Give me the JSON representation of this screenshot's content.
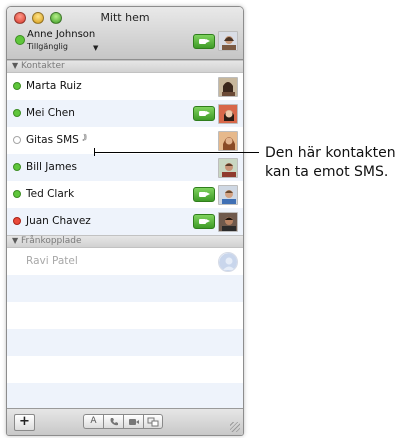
{
  "window": {
    "title": "Mitt hem"
  },
  "me": {
    "name": "Anne Johnson",
    "status": "Tillgänglig",
    "status_color": "#5fc63b"
  },
  "groups": {
    "contacts_label": "Kontakter",
    "offline_label": "Frånkopplade"
  },
  "contacts": [
    {
      "name": "Marta Ruiz",
      "status": "available",
      "video": false
    },
    {
      "name": "Mei Chen",
      "status": "available",
      "video": true
    },
    {
      "name": "Gitas SMS",
      "status": "offline",
      "video": false,
      "sms": true
    },
    {
      "name": "Bill James",
      "status": "available",
      "video": false
    },
    {
      "name": "Ted Clark",
      "status": "available",
      "video": true
    },
    {
      "name": "Juan Chavez",
      "status": "busy",
      "video": true
    }
  ],
  "offline_contacts": [
    {
      "name": "Ravi Patel"
    }
  ],
  "toolbar": {
    "add_label": "+",
    "text_chat_label": "A"
  },
  "callout": {
    "line1": "Den här kontakten",
    "line2": "kan ta emot SMS."
  },
  "colors": {
    "available": "#5fc63b",
    "busy": "#ea4a3a",
    "video_button": "#4caf33",
    "alt_row": "#eef3fb"
  }
}
